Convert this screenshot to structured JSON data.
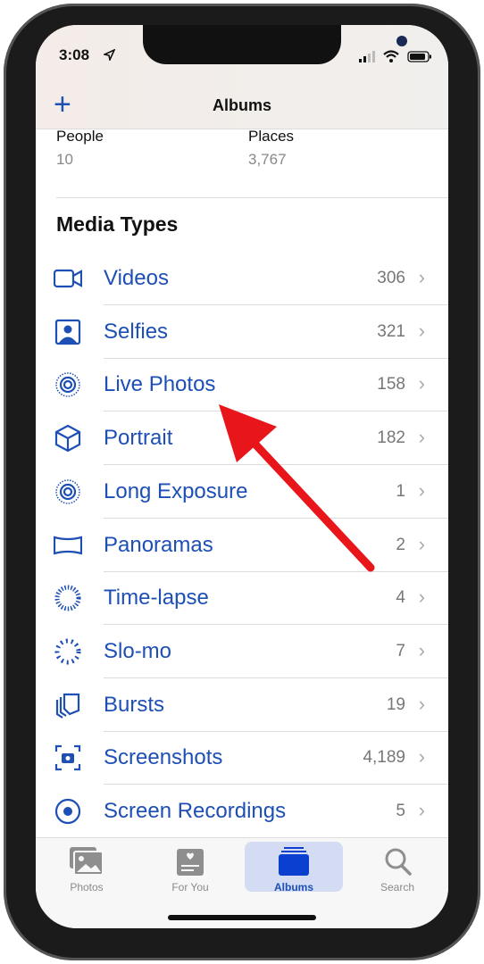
{
  "status_bar": {
    "time": "3:08"
  },
  "header": {
    "title": "Albums",
    "add_icon": "plus-icon"
  },
  "people_places": [
    {
      "label": "People",
      "count": "10"
    },
    {
      "label": "Places",
      "count": "3,767"
    }
  ],
  "media_types": {
    "title": "Media Types",
    "items": [
      {
        "label": "Videos",
        "count": "306",
        "icon": "video-camera-icon"
      },
      {
        "label": "Selfies",
        "count": "321",
        "icon": "selfie-icon"
      },
      {
        "label": "Live Photos",
        "count": "158",
        "icon": "live-photo-icon"
      },
      {
        "label": "Portrait",
        "count": "182",
        "icon": "cube-icon"
      },
      {
        "label": "Long Exposure",
        "count": "1",
        "icon": "long-exposure-icon"
      },
      {
        "label": "Panoramas",
        "count": "2",
        "icon": "panorama-icon"
      },
      {
        "label": "Time-lapse",
        "count": "4",
        "icon": "timelapse-icon"
      },
      {
        "label": "Slo-mo",
        "count": "7",
        "icon": "slomo-icon"
      },
      {
        "label": "Bursts",
        "count": "19",
        "icon": "bursts-icon"
      },
      {
        "label": "Screenshots",
        "count": "4,189",
        "icon": "screenshot-icon"
      },
      {
        "label": "Screen Recordings",
        "count": "5",
        "icon": "screen-recording-icon"
      }
    ]
  },
  "tabbar": {
    "tabs": [
      {
        "label": "Photos"
      },
      {
        "label": "For You"
      },
      {
        "label": "Albums",
        "active": true
      },
      {
        "label": "Search"
      }
    ]
  },
  "colors": {
    "accent": "#1d4fb5",
    "annotation": "#e8161b"
  }
}
